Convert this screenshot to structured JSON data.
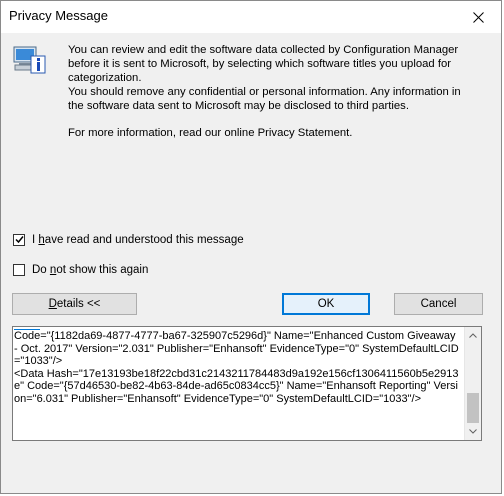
{
  "window": {
    "title": "Privacy Message"
  },
  "message": {
    "para1": "You can review and edit the software data collected by Configuration Manager before it is sent to Microsoft, by selecting which software titles you upload for categorization.",
    "para2": "You should remove any confidential or personal information.  Any information in the software data sent to Microsoft may be disclosed to third parties.",
    "para3": "For more information, read our online Privacy Statement."
  },
  "checkboxes": {
    "understood": {
      "label_pre": "I ",
      "label_accel": "h",
      "label_post": "ave read and understood this message",
      "checked": true
    },
    "dont_show": {
      "label_pre": "Do ",
      "label_accel": "n",
      "label_post": "ot show this again",
      "checked": false
    }
  },
  "buttons": {
    "details": {
      "accel": "D",
      "rest": "etails <<"
    },
    "ok": "OK",
    "cancel": "Cancel"
  },
  "details_text": "Code=\"{1182da69-4877-4777-ba67-325907c5296d}\" Name=\"Enhanced Custom Giveaway - Oct. 2017\" Version=\"2.031\" Publisher=\"Enhansoft\" EvidenceType=\"0\" SystemDefaultLCID=\"1033\"/>\n<Data Hash=\"17e13193be18f22cbd31c2143211784483d9a192e156cf1306411560b5e2913e\" Code=\"{57d46530-be82-4b63-84de-ad65c0834cc5}\" Name=\"Enhansoft Reporting\" Version=\"6.031\" Publisher=\"Enhansoft\" EvidenceType=\"0\" SystemDefaultLCID=\"1033\"/>",
  "colors": {
    "accent": "#0078d7",
    "window_bg": "#f0f0f0",
    "button_bg": "#e1e1e1"
  }
}
